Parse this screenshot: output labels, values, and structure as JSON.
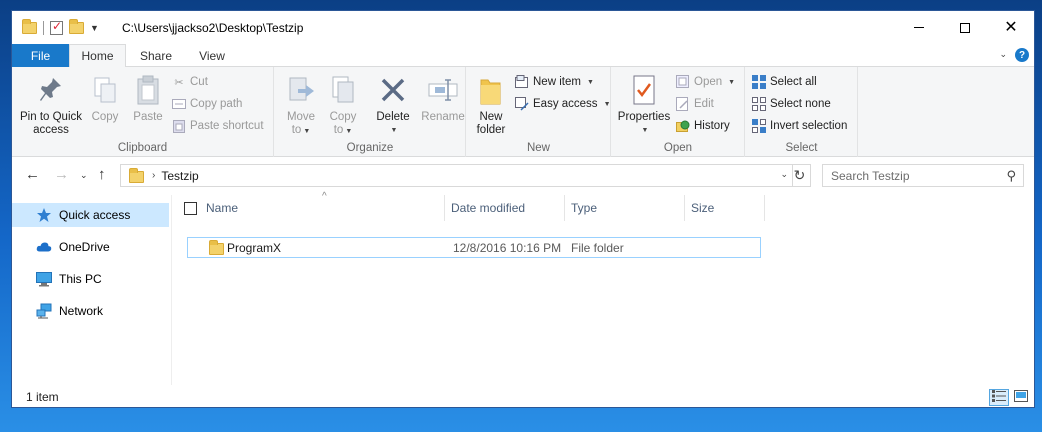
{
  "window": {
    "path_title": "C:\\Users\\jjackso2\\Desktop\\Testzip"
  },
  "tabs": {
    "file": "File",
    "home": "Home",
    "share": "Share",
    "view": "View",
    "help": "?"
  },
  "ribbon": {
    "clipboard": {
      "label": "Clipboard",
      "pin_line1": "Pin to Quick",
      "pin_line2": "access",
      "copy": "Copy",
      "paste": "Paste",
      "cut": "Cut",
      "copy_path": "Copy path",
      "paste_shortcut": "Paste shortcut"
    },
    "organize": {
      "label": "Organize",
      "move_line1": "Move",
      "move_line2": "to",
      "copy_line1": "Copy",
      "copy_line2": "to",
      "delete": "Delete",
      "rename": "Rename"
    },
    "new": {
      "label": "New",
      "new_folder_line1": "New",
      "new_folder_line2": "folder",
      "new_item": "New item",
      "easy_access": "Easy access"
    },
    "open": {
      "label": "Open",
      "properties": "Properties",
      "open": "Open",
      "edit": "Edit",
      "history": "History"
    },
    "select": {
      "label": "Select",
      "select_all": "Select all",
      "select_none": "Select none",
      "invert_selection": "Invert selection"
    }
  },
  "address": {
    "current_folder": "Testzip",
    "search_placeholder": "Search Testzip"
  },
  "nav": {
    "items": [
      {
        "label": "Quick access",
        "icon": "star-icon"
      },
      {
        "label": "OneDrive",
        "icon": "cloud-icon"
      },
      {
        "label": "This PC",
        "icon": "monitor-icon"
      },
      {
        "label": "Network",
        "icon": "network-icon"
      }
    ]
  },
  "columns": {
    "name": "Name",
    "date_modified": "Date modified",
    "type": "Type",
    "size": "Size"
  },
  "files": [
    {
      "name": "ProgramX",
      "date_modified": "12/8/2016 10:16 PM",
      "type": "File folder",
      "size": ""
    }
  ],
  "status": {
    "item_count": "1 item"
  },
  "colors": {
    "accent": "#1979ca",
    "selection": "#cce8ff",
    "row_border": "#99d1ff"
  }
}
